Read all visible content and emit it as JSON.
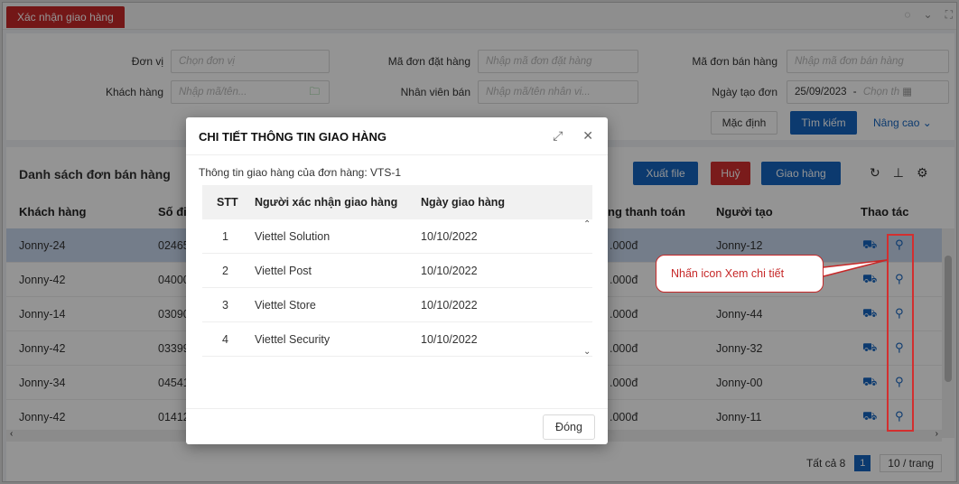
{
  "topbar": {
    "active_tab": "Xác nhận giao hàng",
    "icons": [
      "refresh-icon",
      "chevron-down-icon",
      "fullscreen-icon"
    ]
  },
  "filter": {
    "don_vi": {
      "label": "Đơn vị",
      "placeholder": "Chọn đơn vị"
    },
    "ma_don_dat": {
      "label": "Mã đơn đặt hàng",
      "placeholder": "Nhập mã đơn đặt hàng"
    },
    "ma_don_ban": {
      "label": "Mã đơn bán hàng",
      "placeholder": "Nhập mã đơn bán hàng"
    },
    "khach_hang": {
      "label": "Khách hàng",
      "placeholder": "Nhập mã/tên..."
    },
    "nhan_vien": {
      "label": "Nhân viên bán",
      "placeholder": "Nhập mã/tên nhân vi..."
    },
    "ngay_tao": {
      "label": "Ngày tạo đơn",
      "from": "25/09/2023",
      "sep": "-",
      "to_placeholder": "Chọn th"
    },
    "btn_default": "Mặc định",
    "btn_search": "Tìm kiếm",
    "advanced": "Nâng cao"
  },
  "list": {
    "title": "Danh sách đơn bán hàng",
    "btn_export": "Xuất file",
    "btn_cancel": "Huỷ",
    "btn_deliver": "Giao hàng",
    "columns": {
      "khach_hang": "Khách hàng",
      "so_dien_thoai": "Số điệ",
      "thanh_toan": "ng thanh toán",
      "nguoi_tao": "Người tạo",
      "thao_tac": "Thao tác"
    },
    "rows": [
      {
        "khach_hang": "Jonny-24",
        "so_dt": "02465",
        "tien": ".000đ",
        "nguoi_tao": "Jonny-12",
        "selected": true
      },
      {
        "khach_hang": "Jonny-42",
        "so_dt": "04000",
        "tien": ".000đ",
        "nguoi_tao": "",
        "selected": false
      },
      {
        "khach_hang": "Jonny-14",
        "so_dt": "03090",
        "tien": ".000đ",
        "nguoi_tao": "Jonny-44",
        "selected": false
      },
      {
        "khach_hang": "Jonny-42",
        "so_dt": "03399",
        "tien": ".000đ",
        "nguoi_tao": "Jonny-32",
        "selected": false
      },
      {
        "khach_hang": "Jonny-34",
        "so_dt": "04541",
        "tien": ".000đ",
        "nguoi_tao": "Jonny-00",
        "selected": false
      },
      {
        "khach_hang": "Jonny-42",
        "so_dt": "01412",
        "tien": ".000đ",
        "nguoi_tao": "Jonny-11",
        "selected": false
      }
    ],
    "pager": {
      "total": "Tất cả 8",
      "page": "1",
      "size": "10 / trang"
    }
  },
  "modal": {
    "title": "CHI TIẾT THÔNG TIN GIAO HÀNG",
    "subtitle": "Thông tin giao hàng của đơn hàng: VTS-1",
    "headers": {
      "stt": "STT",
      "nguoi": "Người xác nhận giao hàng",
      "ngay": "Ngày giao hàng"
    },
    "rows": [
      {
        "stt": "1",
        "nguoi": "Viettel Solution",
        "ngay": "10/10/2022"
      },
      {
        "stt": "2",
        "nguoi": "Viettel Post",
        "ngay": "10/10/2022"
      },
      {
        "stt": "3",
        "nguoi": "Viettel Store",
        "ngay": "10/10/2022"
      },
      {
        "stt": "4",
        "nguoi": "Viettel Security",
        "ngay": "10/10/2022"
      }
    ],
    "close_btn": "Đóng"
  },
  "annotation": {
    "callout": "Nhấn icon Xem chi tiết",
    "color": "#c62828"
  },
  "colors": {
    "brand_red": "#c62828",
    "primary_blue": "#1565c0",
    "selected_row": "#c9d8ee"
  }
}
